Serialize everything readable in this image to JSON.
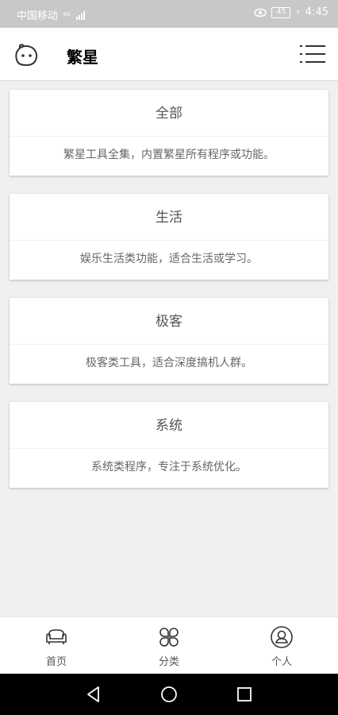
{
  "status_bar": {
    "carrier": "中国移动",
    "signal": "4G",
    "battery": "45",
    "time": "4:45"
  },
  "header": {
    "title": "繁星",
    "logo_icon": "face-logo-icon",
    "menu_icon": "list-menu-icon"
  },
  "categories": [
    {
      "title": "全部",
      "description": "繁星工具全集，内置繁星所有程序或功能。"
    },
    {
      "title": "生活",
      "description": "娱乐生活类功能，适合生活或学习。"
    },
    {
      "title": "极客",
      "description": "极客类工具，适合深度搞机人群。"
    },
    {
      "title": "系统",
      "description": "系统类程序，专注于系统优化。"
    }
  ],
  "bottom_nav": [
    {
      "label": "首页",
      "icon": "sofa-icon"
    },
    {
      "label": "分类",
      "icon": "clover-icon"
    },
    {
      "label": "个人",
      "icon": "user-icon"
    }
  ],
  "colors": {
    "background": "#f0f0f0",
    "card": "#ffffff",
    "status_bar": "#c8c8c8",
    "system_nav": "#000000"
  }
}
